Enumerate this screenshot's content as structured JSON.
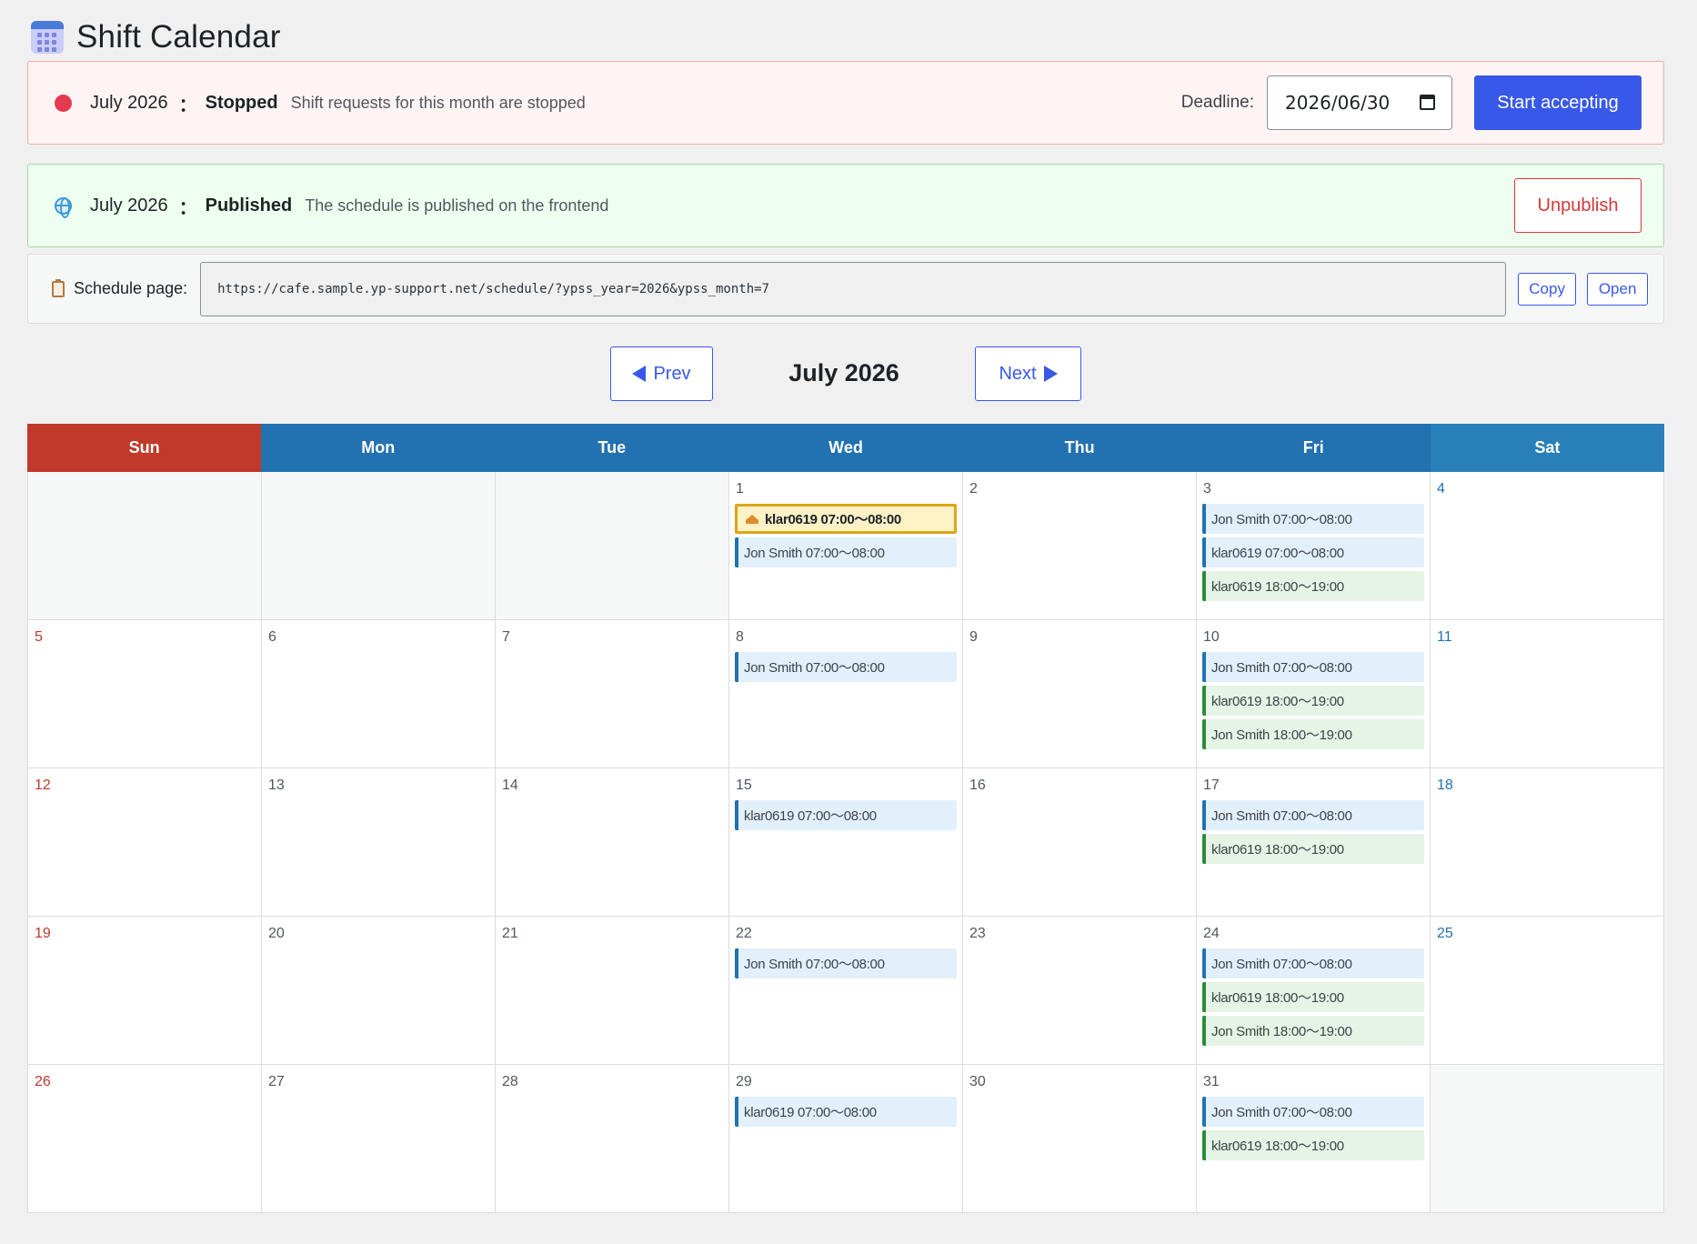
{
  "page": {
    "title": "Shift Calendar"
  },
  "stopped_banner": {
    "month": "July 2026",
    "separator": "：",
    "status": "Stopped",
    "description": "Shift requests for this month are stopped",
    "deadline_label": "Deadline:",
    "deadline_value": "2026/06/30",
    "action_label": "Start accepting",
    "status_color": "#e23b50"
  },
  "published_banner": {
    "month": "July 2026",
    "separator": "：",
    "status": "Published",
    "description": "The schedule is published on the frontend",
    "action_label": "Unpublish"
  },
  "schedule_page": {
    "label": "Schedule page:",
    "url": "https://cafe.sample.yp-support.net/schedule/?ypss_year=2026&ypss_month=7",
    "copy_label": "Copy",
    "open_label": "Open"
  },
  "nav": {
    "prev_label": "Prev",
    "next_label": "Next",
    "month_label": "July 2026"
  },
  "calendar": {
    "weekdays": [
      "Sun",
      "Mon",
      "Tue",
      "Wed",
      "Thu",
      "Fri",
      "Sat"
    ],
    "weeks": [
      [
        {
          "day": "",
          "shifts": []
        },
        {
          "day": "",
          "shifts": []
        },
        {
          "day": "",
          "shifts": []
        },
        {
          "day": "1",
          "shifts": [
            {
              "text": "klar0619 07:00〜08:00",
              "kind": "leader"
            },
            {
              "text": "Jon Smith 07:00〜08:00",
              "kind": "morning"
            }
          ]
        },
        {
          "day": "2",
          "shifts": []
        },
        {
          "day": "3",
          "shifts": [
            {
              "text": "Jon Smith 07:00〜08:00",
              "kind": "morning"
            },
            {
              "text": "klar0619 07:00〜08:00",
              "kind": "morning"
            },
            {
              "text": "klar0619 18:00〜19:00",
              "kind": "evening"
            }
          ]
        },
        {
          "day": "4",
          "shifts": []
        }
      ],
      [
        {
          "day": "5",
          "shifts": []
        },
        {
          "day": "6",
          "shifts": []
        },
        {
          "day": "7",
          "shifts": []
        },
        {
          "day": "8",
          "shifts": [
            {
              "text": "Jon Smith 07:00〜08:00",
              "kind": "morning"
            }
          ]
        },
        {
          "day": "9",
          "shifts": []
        },
        {
          "day": "10",
          "shifts": [
            {
              "text": "Jon Smith 07:00〜08:00",
              "kind": "morning"
            },
            {
              "text": "klar0619 18:00〜19:00",
              "kind": "evening"
            },
            {
              "text": "Jon Smith 18:00〜19:00",
              "kind": "evening"
            }
          ]
        },
        {
          "day": "11",
          "shifts": []
        }
      ],
      [
        {
          "day": "12",
          "shifts": []
        },
        {
          "day": "13",
          "shifts": []
        },
        {
          "day": "14",
          "shifts": []
        },
        {
          "day": "15",
          "shifts": [
            {
              "text": "klar0619 07:00〜08:00",
              "kind": "morning"
            }
          ]
        },
        {
          "day": "16",
          "shifts": []
        },
        {
          "day": "17",
          "shifts": [
            {
              "text": "Jon Smith 07:00〜08:00",
              "kind": "morning"
            },
            {
              "text": "klar0619 18:00〜19:00",
              "kind": "evening"
            }
          ]
        },
        {
          "day": "18",
          "shifts": []
        }
      ],
      [
        {
          "day": "19",
          "shifts": []
        },
        {
          "day": "20",
          "shifts": []
        },
        {
          "day": "21",
          "shifts": []
        },
        {
          "day": "22",
          "shifts": [
            {
              "text": "Jon Smith 07:00〜08:00",
              "kind": "morning"
            }
          ]
        },
        {
          "day": "23",
          "shifts": []
        },
        {
          "day": "24",
          "shifts": [
            {
              "text": "Jon Smith 07:00〜08:00",
              "kind": "morning"
            },
            {
              "text": "klar0619 18:00〜19:00",
              "kind": "evening"
            },
            {
              "text": "Jon Smith 18:00〜19:00",
              "kind": "evening"
            }
          ]
        },
        {
          "day": "25",
          "shifts": []
        }
      ],
      [
        {
          "day": "26",
          "shifts": []
        },
        {
          "day": "27",
          "shifts": []
        },
        {
          "day": "28",
          "shifts": []
        },
        {
          "day": "29",
          "shifts": [
            {
              "text": "klar0619 07:00〜08:00",
              "kind": "morning"
            }
          ]
        },
        {
          "day": "30",
          "shifts": []
        },
        {
          "day": "31",
          "shifts": [
            {
              "text": "Jon Smith 07:00〜08:00",
              "kind": "morning"
            },
            {
              "text": "klar0619 18:00〜19:00",
              "kind": "evening"
            }
          ]
        },
        {
          "day": "",
          "shifts": []
        }
      ]
    ]
  },
  "colors": {
    "primary": "#3858e9",
    "sunday_header": "#c0392b",
    "weekday_header": "#2271b1",
    "saturday_header": "#2980b9",
    "morning_shift": "#e2f0fc",
    "evening_shift": "#e5f4e5",
    "leader_shift": "#fdf1c6"
  }
}
